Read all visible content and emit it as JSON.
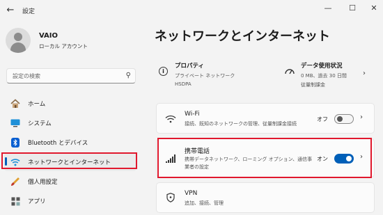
{
  "app": {
    "title": "設定",
    "back": "←",
    "min": "—",
    "max": "☐",
    "close": "✕"
  },
  "profile": {
    "name": "VAIO",
    "type": "ローカル アカウント"
  },
  "search": {
    "placeholder": "設定の検索",
    "icon": "⚲"
  },
  "nav": {
    "items": [
      {
        "label": "ホーム",
        "icon": "home-icon"
      },
      {
        "label": "システム",
        "icon": "system-icon"
      },
      {
        "label": "Bluetooth とデバイス",
        "icon": "bluetooth-icon"
      },
      {
        "label": "ネットワークとインターネット",
        "icon": "wifi-icon"
      },
      {
        "label": "個人用設定",
        "icon": "brush-icon"
      },
      {
        "label": "アプリ",
        "icon": "apps-icon"
      }
    ],
    "selected": "ネットワークとインターネット"
  },
  "main": {
    "title": "ネットワークとインターネット",
    "properties": {
      "title": "プロパティ",
      "line1": "プライベート ネットワーク",
      "line2": "HSDPA",
      "icon": "info-icon"
    },
    "usage": {
      "title": "データ使用状況",
      "line1": "0 MB、過去 30 日間",
      "line2": "従量制課金",
      "icon": "gauge-icon"
    },
    "cards": {
      "wifi": {
        "title": "Wi-Fi",
        "subtitle": "接続、既知のネットワークの管理、従量制課金接続",
        "toggle_label": "オフ",
        "state": "off"
      },
      "cellular": {
        "title": "携帯電話",
        "subtitle1": "携帯データネットワーク、ローミング オプション、通信事",
        "subtitle2": "業者の設定",
        "toggle_label": "オン",
        "state": "on"
      },
      "vpn": {
        "title": "VPN",
        "subtitle": "追加、接続、管理"
      }
    }
  },
  "colors": {
    "accent": "#005fb8",
    "highlight": "#e0182d"
  }
}
